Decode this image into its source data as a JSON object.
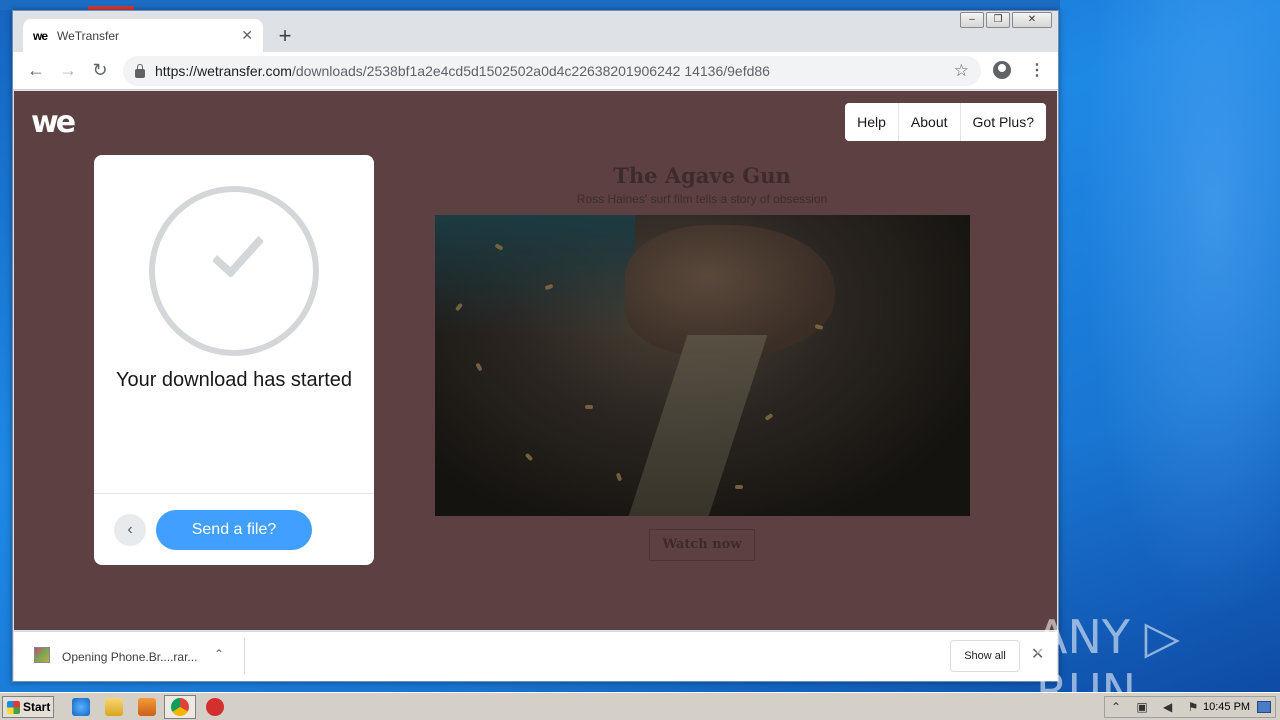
{
  "browser": {
    "tab_title": "WeTransfer",
    "tab_favicon": "we",
    "new_tab_label": "+",
    "url_host": "https://wetransfer.com",
    "url_path": "/downloads/2538bf1a2e4cd5d1502502a0d4c22638201906242 14136/9efd86",
    "window_controls": {
      "minimize": "–",
      "restore": "❐",
      "close": "✕"
    }
  },
  "page": {
    "logo": "we",
    "nav": [
      "Help",
      "About",
      "Got Plus?"
    ],
    "ad": {
      "title": "The Agave Gun",
      "subtitle": "Ross Haines' surf film tells a story of obsession",
      "cta": "Watch now"
    },
    "card": {
      "message": "Your download has started",
      "send_button": "Send a file?",
      "back_icon": "chevron-left-icon"
    }
  },
  "download_bar": {
    "item_label": "Opening Phone.Br....rar...",
    "show_all": "Show all"
  },
  "watermark": "ANY ▷ RUN",
  "taskbar": {
    "start_label": "Start",
    "clock": "10:45 PM"
  }
}
